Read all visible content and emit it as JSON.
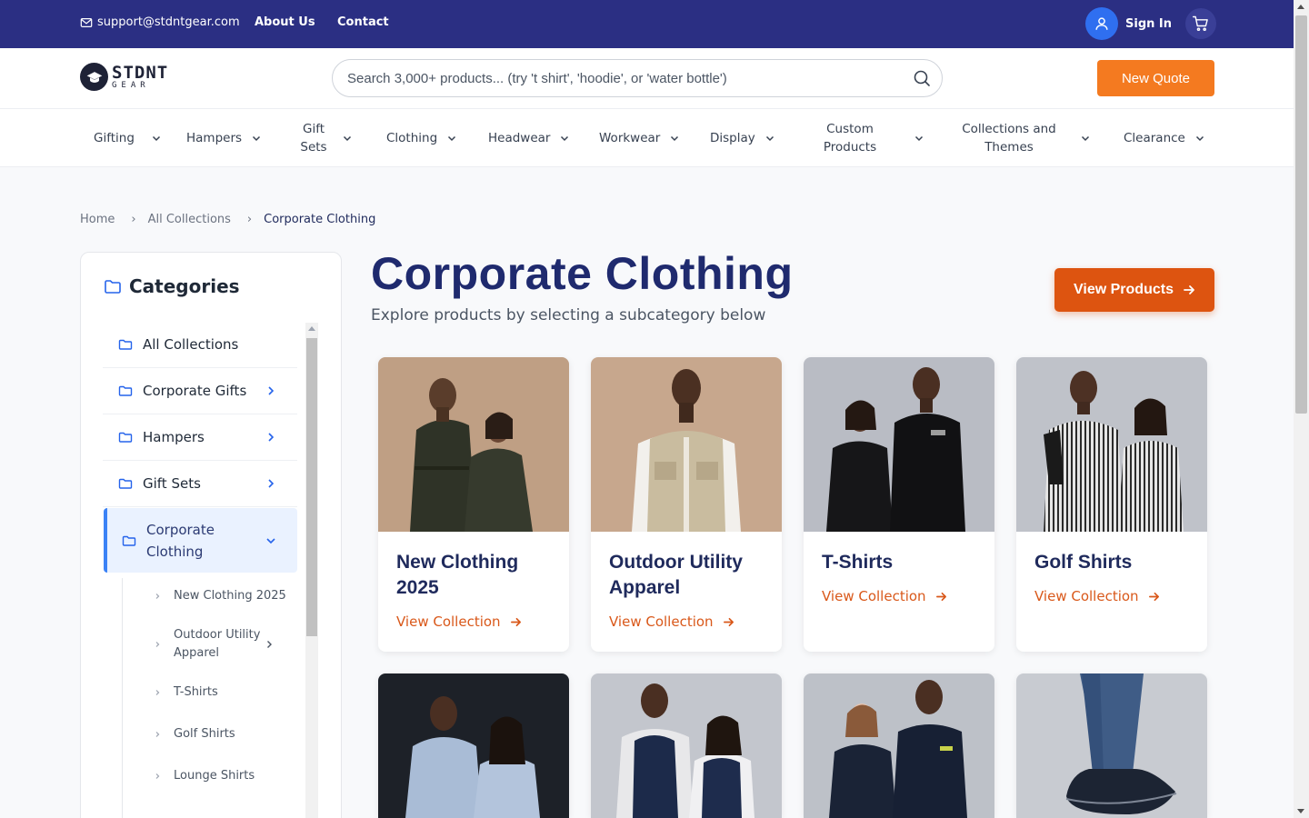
{
  "topbar": {
    "email": "support@stdntgear.com",
    "about": "About Us",
    "contact": "Contact",
    "signin": "Sign In",
    "bg_color": "#2b2f83",
    "icons": {
      "email": "mail-icon",
      "user": "user-icon",
      "cart": "cart-icon"
    }
  },
  "header": {
    "logo_main": "STDNT",
    "logo_sub": "GEAR",
    "search_placeholder": "Search 3,000+ products... (try 't shirt', 'hoodie', or 'water bottle')",
    "new_quote": "New Quote",
    "accent_color": "#f47a20"
  },
  "nav": {
    "items": [
      {
        "label": "Gifting"
      },
      {
        "label": "Hampers"
      },
      {
        "label": "Gift Sets"
      },
      {
        "label": "Clothing"
      },
      {
        "label": "Headwear"
      },
      {
        "label": "Workwear"
      },
      {
        "label": "Display"
      },
      {
        "label": "Custom Products"
      },
      {
        "label": "Collections and Themes"
      },
      {
        "label": "Clearance"
      }
    ]
  },
  "breadcrumb": {
    "home": "Home",
    "all": "All Collections",
    "current": "Corporate Clothing"
  },
  "sidebar": {
    "title": "Categories",
    "items": [
      {
        "label": "All Collections"
      },
      {
        "label": "Corporate Gifts"
      },
      {
        "label": "Hampers"
      },
      {
        "label": "Gift Sets"
      }
    ],
    "active": {
      "label": "Corporate Clothing"
    },
    "subitems": [
      {
        "label": "New Clothing 2025"
      },
      {
        "label": "Outdoor Utility Apparel"
      },
      {
        "label": "T-Shirts"
      },
      {
        "label": "Golf Shirts"
      },
      {
        "label": "Lounge Shirts"
      }
    ]
  },
  "main": {
    "title": "Corporate Clothing",
    "subtitle": "Explore products by selecting a subcategory below",
    "view_products": "View Products",
    "view_collection": "View Collection",
    "cards": [
      {
        "title": "New Clothing 2025"
      },
      {
        "title": "Outdoor Utility Apparel"
      },
      {
        "title": "T-Shirts"
      },
      {
        "title": "Golf Shirts"
      }
    ],
    "title_color": "#1f2a6e",
    "cta_color": "#dd5410"
  }
}
